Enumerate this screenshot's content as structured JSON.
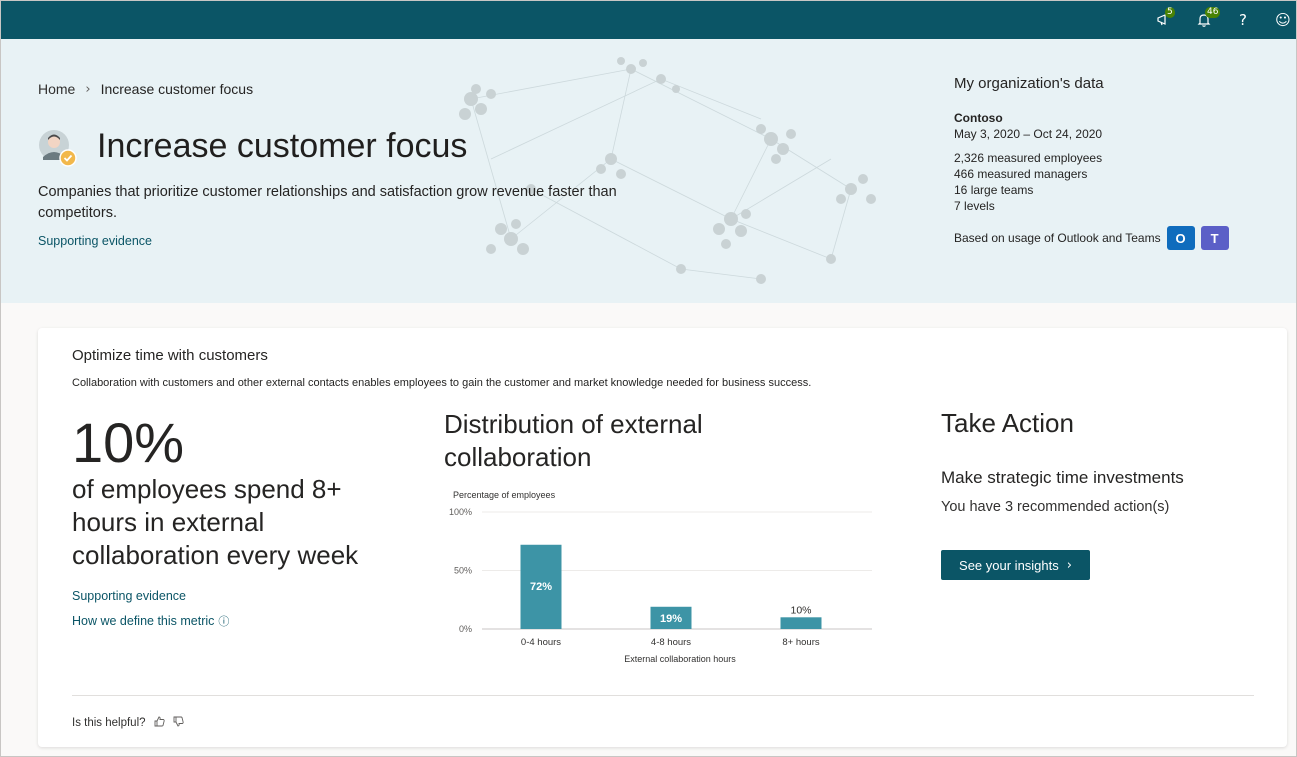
{
  "topbar": {
    "megaphone_badge": "5",
    "bell_badge": "46",
    "help_glyph": "?",
    "feedback_glyph": "☺",
    "icons": [
      "megaphone-icon",
      "bell-icon",
      "help-icon",
      "smiley-icon"
    ]
  },
  "breadcrumb": {
    "home": "Home",
    "current": "Increase customer focus"
  },
  "hero": {
    "title": "Increase customer focus",
    "description": "Companies that prioritize customer relationships and satisfaction grow revenue faster than competitors.",
    "link": "Supporting evidence"
  },
  "org": {
    "title": "My organization's data",
    "name": "Contoso",
    "dates": "May 3, 2020 – Oct 24, 2020",
    "employees_num": "2,326",
    "employees_label": " measured employees",
    "managers_num": "466",
    "managers_label": " measured managers",
    "teams_num": "16",
    "teams_label": " large teams",
    "levels_num": "7",
    "levels_label": " levels",
    "usage": "Based on usage of Outlook and Teams",
    "outlook_letter": "O",
    "teams_letter": "T"
  },
  "card": {
    "title": "Optimize time with customers",
    "subtitle": "Collaboration with customers and other external contacts enables employees to gain the customer and market knowledge needed for business success.",
    "big_number": "10%",
    "big_text": "of employees spend 8+ hours in external collaboration every week",
    "link_evidence": "Supporting evidence",
    "link_define": "How we define this metric",
    "chart_title": "Distribution of external collaboration",
    "take_action": "Take Action",
    "ta_sub": "Make strategic time investments",
    "ta_count": "You have 3 recommended action(s)",
    "ta_button": "See your insights",
    "helpful": "Is this helpful?"
  },
  "chart_data": {
    "type": "bar",
    "categories": [
      "0-4 hours",
      "4-8 hours",
      "8+ hours"
    ],
    "values": [
      72,
      19,
      10
    ],
    "data_labels": [
      "72%",
      "19%",
      "10%"
    ],
    "ylabel": "Percentage of employees",
    "xlabel": "External collaboration hours",
    "ylim": [
      0,
      100
    ],
    "yticks": [
      "0%",
      "50%",
      "100%"
    ],
    "ytick_values": [
      0,
      50,
      100
    ],
    "grid": true,
    "bar_color": "#3d94a6"
  },
  "colors": {
    "brand": "#0b5566",
    "hero_bg": "#e8f2f5",
    "bar": "#3d94a6"
  }
}
